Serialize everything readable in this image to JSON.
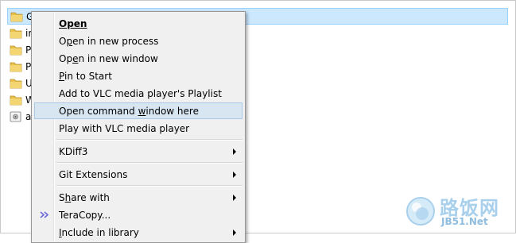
{
  "files": [
    {
      "name": "G",
      "icon": "folder-icon",
      "selected": true
    },
    {
      "name": "in",
      "icon": "folder-icon"
    },
    {
      "name": "P",
      "icon": "folder-icon"
    },
    {
      "name": "P",
      "icon": "folder-icon"
    },
    {
      "name": "U",
      "icon": "folder-icon"
    },
    {
      "name": "W",
      "icon": "folder-icon"
    },
    {
      "name": "a",
      "icon": "disk-icon"
    }
  ],
  "menu": {
    "items": [
      {
        "label": "Open",
        "mnemonic": "O",
        "bold": true
      },
      {
        "label": "Open in new process",
        "mnemonic": "p"
      },
      {
        "label": "Open in new window",
        "mnemonic": "e"
      },
      {
        "label": "Pin to Start",
        "mnemonic": "P"
      },
      {
        "label": "Add to VLC media player's Playlist"
      },
      {
        "label": "Open command window here",
        "mnemonic": "w",
        "hovered": true
      },
      {
        "label": "Play with VLC media player"
      },
      {
        "label": "KDiff3",
        "submenu": true
      },
      {
        "label": "Git Extensions",
        "submenu": true
      },
      {
        "label": "Share with",
        "mnemonic": "h",
        "submenu": true
      },
      {
        "label": "TeraCopy...",
        "icon": "teracopy-icon"
      },
      {
        "label": "Include in library",
        "mnemonic": "I",
        "submenu": true
      }
    ]
  },
  "watermark": {
    "cn_text": "路饭网",
    "en_text": "JB51.Net"
  },
  "colors": {
    "selection_bg": "#cce8ff",
    "menu_hover_bg": "#d8e6f2",
    "menu_bg": "#f0f0f0",
    "folder": "#e8c04a"
  }
}
